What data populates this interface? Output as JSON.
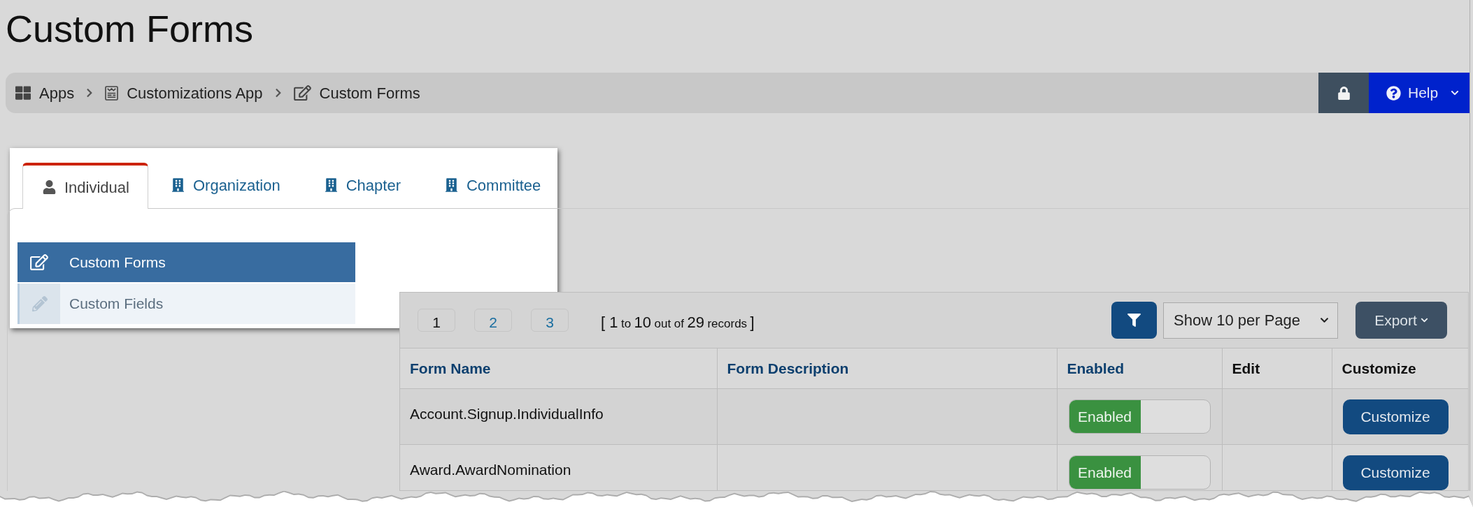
{
  "page": {
    "title": "Custom Forms"
  },
  "breadcrumb": [
    {
      "label": "Apps"
    },
    {
      "label": "Customizations App"
    },
    {
      "label": "Custom Forms"
    }
  ],
  "help_menu": {
    "label": "Help"
  },
  "tabs": [
    {
      "label": "Individual",
      "kind": "person",
      "selected": true
    },
    {
      "label": "Organization",
      "kind": "organization",
      "selected": false
    },
    {
      "label": "Chapter",
      "kind": "organization",
      "selected": false
    },
    {
      "label": "Committee",
      "kind": "organization",
      "selected": false
    }
  ],
  "side_menu": [
    {
      "label": "Custom Forms",
      "selected": true
    },
    {
      "label": "Custom Fields",
      "selected": false
    }
  ],
  "pagination": [
    {
      "label": "1",
      "selected": true
    },
    {
      "label": "2",
      "selected": false
    },
    {
      "label": "3",
      "selected": false
    }
  ],
  "records_summary": [
    {
      "text": "[ 1",
      "kind": "large"
    },
    {
      "text": "to",
      "kind": "small"
    },
    {
      "text": "10",
      "kind": "large"
    },
    {
      "text": "out of",
      "kind": "small"
    },
    {
      "text": "29",
      "kind": "large"
    },
    {
      "text": "records",
      "kind": "small"
    },
    {
      "text": "]",
      "kind": "large"
    }
  ],
  "page_size_select": {
    "value": "Show 10 per Page"
  },
  "export_button": {
    "label": "Export"
  },
  "table": {
    "columns": [
      {
        "label": "Form Name",
        "sortable": true
      },
      {
        "label": "Form Description",
        "sortable": true
      },
      {
        "label": "Enabled",
        "sortable": true
      },
      {
        "label": "Edit",
        "sortable": false
      },
      {
        "label": "Customize",
        "sortable": false
      }
    ],
    "rows": [
      {
        "form_name": "Account.Signup.IndividualInfo",
        "enabled_switch": {
          "label": "Enabled",
          "on": true
        },
        "action": "Customize"
      },
      {
        "form_name": "Award.AwardNomination",
        "enabled_switch": {
          "label": "Enabled",
          "on": true
        },
        "action": "Customize"
      }
    ]
  }
}
